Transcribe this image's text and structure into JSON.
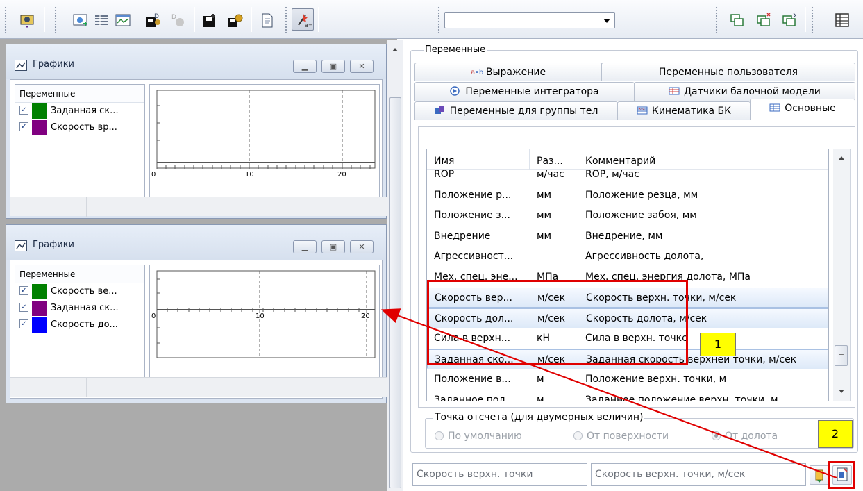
{
  "toolbar": {
    "combo_value": "",
    "buttons": [
      "camera-icon",
      "graph-add-icon",
      "list-icon",
      "graph-window-icon",
      "data-load-icon",
      "data-load-disabled-icon",
      "save-icon",
      "settings-save-icon",
      "document-icon",
      "variables-wizard-icon",
      "cascade-windows-icon",
      "close-window-icon",
      "tile-windows-icon",
      "table-icon"
    ]
  },
  "graph_windows": [
    {
      "title": "Графики",
      "list_header": "Переменные",
      "variables": [
        {
          "label": "Заданная ск...",
          "color": "#008000",
          "checked": true
        },
        {
          "label": "Скорость вр...",
          "color": "#800080",
          "checked": true
        }
      ],
      "x_ticks": [
        "0",
        "10",
        "20"
      ]
    },
    {
      "title": "Графики",
      "list_header": "Переменные",
      "variables": [
        {
          "label": "Скорость ве...",
          "color": "#008000",
          "checked": true
        },
        {
          "label": "Заданная ск...",
          "color": "#800080",
          "checked": true
        },
        {
          "label": "Скорость до...",
          "color": "#0000ff",
          "checked": true
        }
      ],
      "x_ticks": [
        "0",
        "10",
        "20"
      ]
    }
  ],
  "panel": {
    "group_title": "Переменные",
    "tabs_row1": [
      {
        "label": "Выражение",
        "icon": "expression-icon"
      },
      {
        "label": "Переменные пользователя",
        "icon": ""
      }
    ],
    "tabs_row2": [
      {
        "label": "Переменные интегратора",
        "icon": "integrator-icon"
      },
      {
        "label": "Датчики балочной модели",
        "icon": "sensors-icon"
      }
    ],
    "tabs_row3": [
      {
        "label": "Переменные для группы тел",
        "icon": "bodies-group-icon"
      },
      {
        "label": "Кинематика БК",
        "icon": "kinematics-icon"
      },
      {
        "label": "Основные",
        "icon": "main-icon"
      }
    ],
    "table": {
      "columns": [
        "Имя",
        "Раз...",
        "Комментарий"
      ],
      "rows": [
        {
          "name": "ROP",
          "unit": "м/час",
          "comment": "ROP, м/час",
          "selected": false
        },
        {
          "name": "Положение р...",
          "unit": "мм",
          "comment": "Положение резца, мм",
          "selected": false
        },
        {
          "name": "Положение з...",
          "unit": "мм",
          "comment": "Положение забоя, мм",
          "selected": false
        },
        {
          "name": "Внедрение",
          "unit": "мм",
          "comment": "Внедрение, мм",
          "selected": false
        },
        {
          "name": "Агрессивност...",
          "unit": "",
          "comment": "Агрессивность долота,",
          "selected": false
        },
        {
          "name": "Мех. спец. эне...",
          "unit": "МПа",
          "comment": "Мех. спец. энергия долота, МПа",
          "selected": false
        },
        {
          "name": "Скорость вер...",
          "unit": "м/сек",
          "comment": "Скорость верхн. точки, м/сек",
          "selected": true
        },
        {
          "name": "Скорость дол...",
          "unit": "м/сек",
          "comment": "Скорость долота, м/сек",
          "selected": true
        },
        {
          "name": "Сила в верхн...",
          "unit": "кН",
          "comment": "Сила в верхн. точке",
          "selected": false
        },
        {
          "name": "Заданная ско...",
          "unit": "м/сек",
          "comment": "Заданная скорость верхней точки, м/сек",
          "selected": true
        },
        {
          "name": "Положение в...",
          "unit": "м",
          "comment": "Положение верхн. точки, м",
          "selected": false
        },
        {
          "name": "Заданное пол...",
          "unit": "м",
          "comment": "Заданное положение верхн. точки, м",
          "selected": false
        }
      ]
    },
    "reference": {
      "title": "Точка отсчета (для двумерных величин)",
      "options": [
        {
          "label": "По умолчанию",
          "selected": false
        },
        {
          "label": "От поверхности",
          "selected": false
        },
        {
          "label": "От долота",
          "selected": true
        }
      ]
    },
    "name_field": "Скорость верхн. точки",
    "comment_field": "Скорость верхн. точки, м/сек"
  },
  "annotations": {
    "label1": "1",
    "label2": "2",
    "color": "#e00000"
  }
}
